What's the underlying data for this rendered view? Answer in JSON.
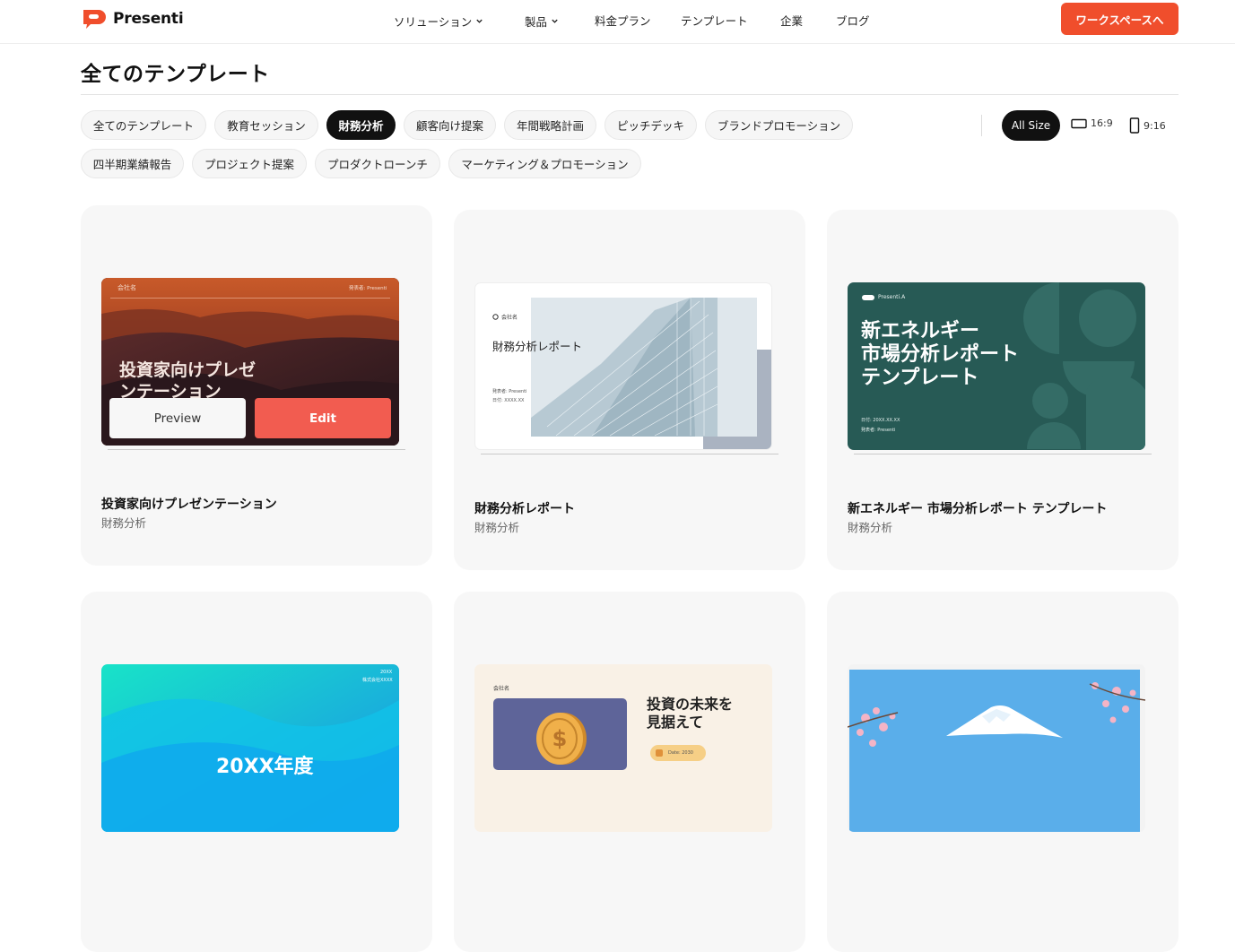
{
  "brand": {
    "name": "Presenti",
    "accent": "#f04e2c"
  },
  "nav": {
    "items": [
      "ソリューション",
      "製品",
      "料金プラン",
      "テンプレート",
      "企業",
      "ブログ"
    ],
    "cta": "ワークスペースへ"
  },
  "page": {
    "title": "全てのテンプレート"
  },
  "filters": {
    "categories": [
      "全てのテンプレート",
      "教育セッション",
      "財務分析",
      "顧客向け提案",
      "年間戦略計画",
      "ピッチデッキ",
      "ブランドプロモーション",
      "四半期業績報告",
      "プロジェクト提案",
      "プロダクトローンチ",
      "マーケティング＆プロモーション"
    ],
    "active": "財務分析",
    "sizes": {
      "all": "All Size",
      "wide": "16:9",
      "tall": "9:16"
    }
  },
  "cards": [
    {
      "title": "投資家向けプレゼンテーション",
      "category": "財務分析",
      "thumb": {
        "company": "会社名",
        "presenter": "発表者: Presenti",
        "heading_line1": "投資家向けプレゼ",
        "heading_line2": "ンテーション"
      },
      "actions": {
        "preview": "Preview",
        "edit": "Edit"
      }
    },
    {
      "title": "財務分析レポート",
      "category": "財務分析",
      "thumb": {
        "company": "会社名",
        "heading": "財務分析レポート",
        "presenter": "発表者: Presenti",
        "date": "日付: XXXX.XX"
      }
    },
    {
      "title": "新エネルギー 市場分析レポート テンプレート",
      "category": "財務分析",
      "thumb": {
        "logo": "Presenti.A",
        "heading_line1": "新エネルギー",
        "heading_line2": "市場分析レポート",
        "heading_line3": "テンプレート",
        "date": "日付: 20XX.XX.XX",
        "presenter": "発表者: Presenti"
      }
    },
    {
      "thumb": {
        "year": "20XX",
        "company": "株式会社XXXX",
        "heading": "20XX年度"
      }
    },
    {
      "thumb": {
        "company": "会社名",
        "heading_line1": "投資の未来を",
        "heading_line2": "見据えて",
        "tag": "Date: 2030"
      }
    },
    {
      "thumb": {}
    }
  ]
}
